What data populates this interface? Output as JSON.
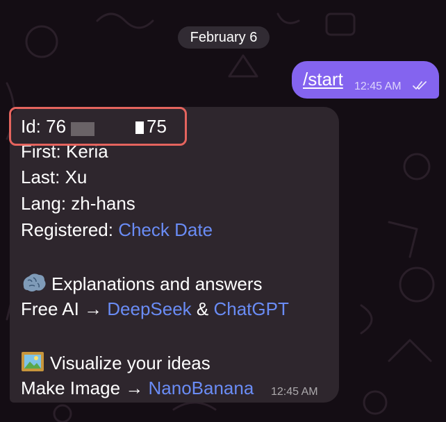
{
  "chat": {
    "date_separator": "February 6",
    "outgoing": {
      "text": "/start",
      "time": "12:45 AM"
    },
    "incoming": {
      "id_prefix": "Id: 76",
      "id_suffix": "75",
      "first_line": "First: Keria",
      "last_line": "Last: Xu",
      "lang_line": "Lang: zh-hans",
      "registered_label": "Registered: ",
      "registered_link": "Check Date",
      "section1_title": "Explanations and answers",
      "section1_prefix": "Free AI → ",
      "section1_link1": "DeepSeek",
      "section1_sep": " & ",
      "section1_link2": "ChatGPT",
      "section2_title": "Visualize your ideas",
      "section2_prefix": "Make Image → ",
      "section2_link": "NanoBanana",
      "time": "12:45 AM"
    }
  },
  "icons": {
    "section1": "brain-icon",
    "section2": "framed-picture-icon",
    "read_status": "double-check-icon"
  },
  "colors": {
    "outgoing_bubble": "#8464ef",
    "incoming_bubble": "#2e262d",
    "link": "#6a8cf5",
    "highlight_border": "#e5645e"
  }
}
